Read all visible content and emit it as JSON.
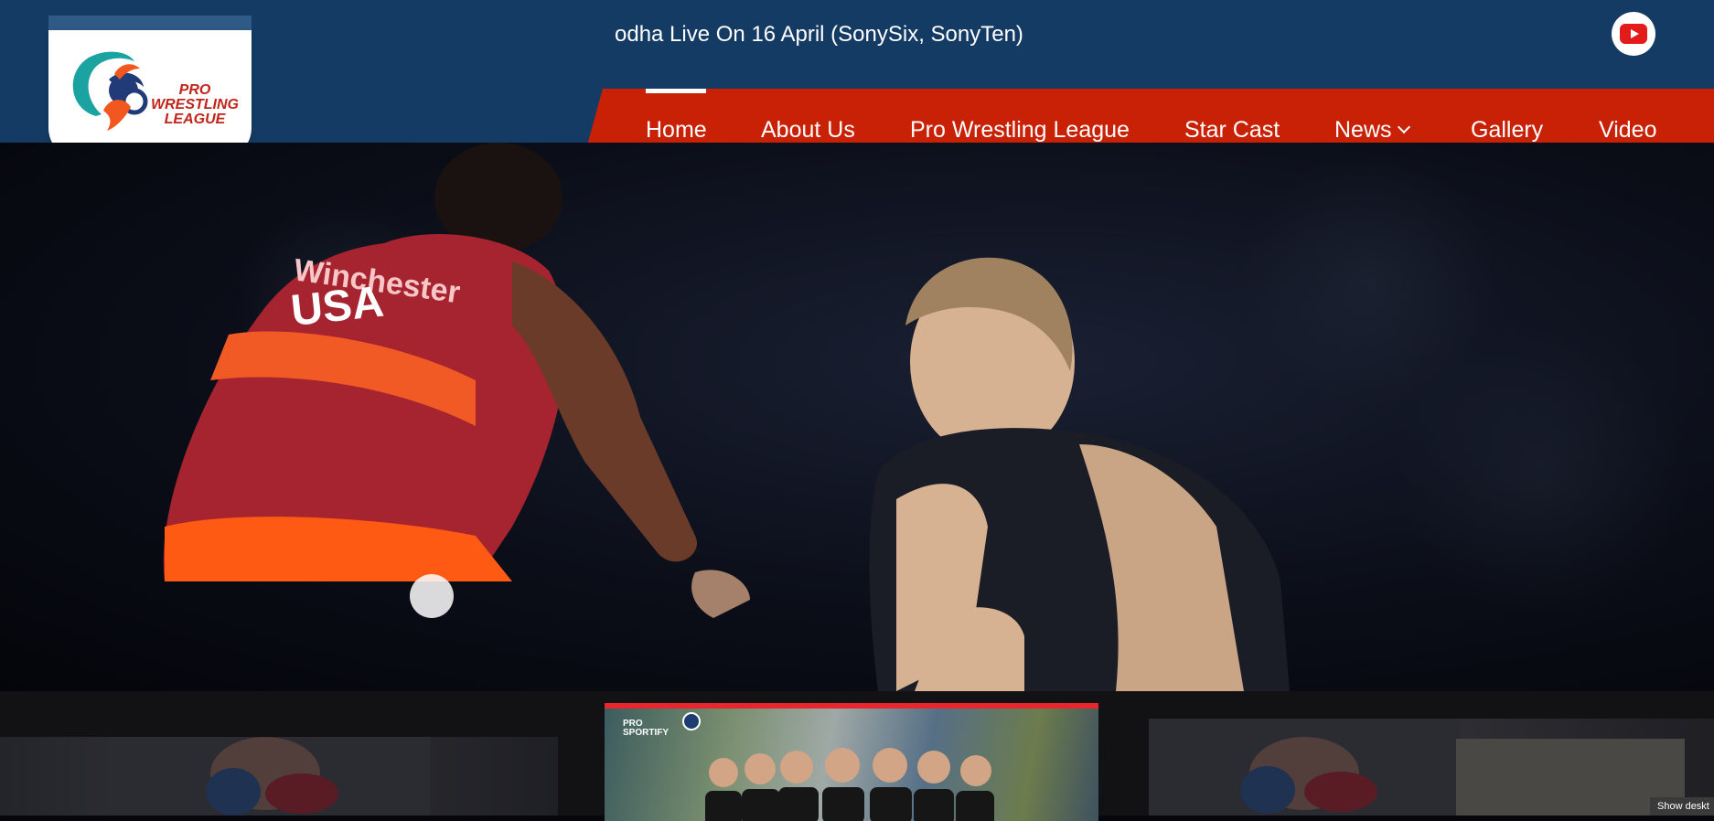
{
  "ticker": {
    "text": "odha Live On 16 April (SonySix, SonyTen)"
  },
  "social": {
    "youtube_icon": "youtube-icon"
  },
  "logo": {
    "line1": "PRO",
    "line2": "WRESTLING",
    "line3": "LEAGUE"
  },
  "nav": {
    "items": [
      {
        "label": "Home",
        "active": true
      },
      {
        "label": "About Us"
      },
      {
        "label": "Pro Wrestling League"
      },
      {
        "label": "Star Cast"
      },
      {
        "label": "News"
      },
      {
        "label": "Gallery"
      },
      {
        "label": "Video"
      }
    ]
  },
  "hero": {
    "singlet_text1": "Winchester",
    "singlet_text2": "USA"
  },
  "carousel": {
    "center_brand_line1": "PRO",
    "center_brand_line2": "SPORTIFY"
  },
  "corner_button": {
    "label": "Show deskt"
  },
  "colors": {
    "topbar": "#143b63",
    "nav": "#c92106",
    "accent_red": "#e7272d"
  }
}
